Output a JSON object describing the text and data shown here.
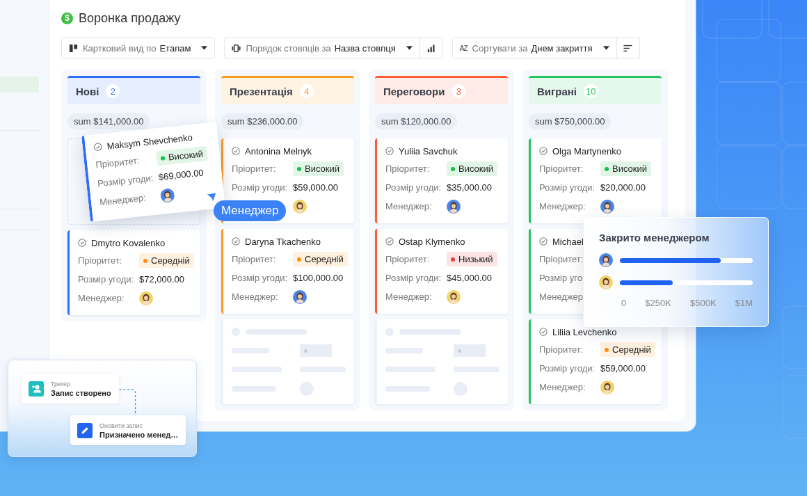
{
  "title": "Воронка продажу",
  "title_icon": "$",
  "toolbar": [
    {
      "label": "Картковий вид по",
      "value": "Етапам"
    },
    {
      "label": "Порядок стовпців за",
      "value": "Назва стовпця"
    },
    {
      "icon_text": "AZ",
      "label": "Сортувати за",
      "value": "Днем закриття"
    }
  ],
  "columns": [
    {
      "name": "Нові",
      "count": "2",
      "color": "#2f6bff",
      "sum": "sum $141,000.00",
      "drop_placeholder": true,
      "cards": [
        {
          "kind": "deal",
          "name": "Dmytro Kovalenko",
          "priority_label": "Пріоритет:",
          "priority": {
            "text": "Середній",
            "kind": "medium"
          },
          "deal_label": "Розмір угоди:",
          "deal_value": "$72,000.00",
          "manager_label": "Менеджер:",
          "manager": {
            "color": "#f0d36a"
          }
        }
      ]
    },
    {
      "name": "Презентація",
      "count": "4",
      "color": "#ff9a1f",
      "sum": "sum $236,000.00",
      "drop_placeholder": false,
      "cards": [
        {
          "kind": "deal",
          "name": "Antonina Melnyk",
          "priority_label": "Пріоритет:",
          "priority": {
            "text": "Високий",
            "kind": "high"
          },
          "deal_label": "Розмір угоди:",
          "deal_value": "$59,000.00",
          "manager": {
            "color": "#f0d36a"
          }
        },
        {
          "kind": "deal",
          "name": "Daryna Tkachenko",
          "priority_label": "Пріоритет:",
          "priority": {
            "text": "Середній",
            "kind": "medium"
          },
          "deal_label": "Розмір угоди:",
          "deal_value": "$100,000.00",
          "manager_label": "Менеджер:",
          "manager": {
            "color": "#4a84ea"
          }
        },
        {
          "kind": "skeleton"
        }
      ]
    },
    {
      "name": "Переговори",
      "count": "3",
      "color": "#ff5a36",
      "sum": "sum $120,000.00",
      "drop_placeholder": false,
      "cards": [
        {
          "kind": "deal",
          "name": "Yuliia Savchuk",
          "priority_label": "Пріоритет:",
          "priority": {
            "text": "Високий",
            "kind": "high"
          },
          "deal_label": "Розмір угоди:",
          "deal_value": "$35,000.00",
          "manager_label": "Менеджер:",
          "manager": {
            "color": "#4a84ea"
          }
        },
        {
          "kind": "deal",
          "name": "Ostap Klymenko",
          "priority_label": "Пріоритет:",
          "priority": {
            "text": "Низький",
            "kind": "low"
          },
          "deal_label": "Розмір угоди:",
          "deal_value": "$45,000.00",
          "manager_label": "Менеджер:",
          "manager": {
            "color": "#f0d36a"
          }
        },
        {
          "kind": "skeleton"
        }
      ]
    },
    {
      "name": "Виграні",
      "count": "10",
      "color": "#22c55e",
      "sum": "sum $750,000.00",
      "drop_placeholder": false,
      "cards": [
        {
          "kind": "deal",
          "name": "Olga Martynenko",
          "priority_label": "Пріоритет:",
          "priority": {
            "text": "Високий",
            "kind": "high"
          },
          "deal_label": "Розмір угоди:",
          "deal_value": "$20,000.00",
          "manager_label": "Менеджер:",
          "manager": {
            "color": "#4a84ea"
          }
        },
        {
          "kind": "deal",
          "name": "Michael",
          "priority_label": "Пріоритет:",
          "deal_label": "Розмір уго",
          "manager_label": "Менеджер"
        },
        {
          "kind": "deal",
          "name": "Liliia Levchenko",
          "priority_label": "Пріоритет:",
          "priority": {
            "text": "Середній",
            "kind": "medium"
          },
          "deal_label": "Розмір угоди:",
          "deal_value": "$59,000.00",
          "manager_label": "Менеджер:",
          "manager": {
            "color": "#f0d36a"
          }
        }
      ]
    }
  ],
  "dragged_card": {
    "kind": "deal",
    "name": "Maksym Shevchenko",
    "priority_label": "Пріоритет:",
    "priority": {
      "text": "Високий",
      "kind": "high"
    },
    "deal_label": "Розмір угоди:",
    "deal_value": "$69,000.00",
    "manager_label": "Менеджер:",
    "manager": {
      "color": "#4a84ea"
    }
  },
  "cursor_label": "Менеджер",
  "closed_by_manager": {
    "title": "Закрито менеджером",
    "rows": [
      {
        "color": "#4a84ea",
        "level": 0.76
      },
      {
        "color": "#f0d36a",
        "level": 0.4
      }
    ],
    "axis": [
      "0",
      "$250K",
      "$500K",
      "$1M"
    ]
  },
  "workflow": {
    "trigger": {
      "caption": "Тригер",
      "title": "Запис створено"
    },
    "action": {
      "caption": "Оновити запис",
      "title": "Призначено менед…"
    }
  }
}
